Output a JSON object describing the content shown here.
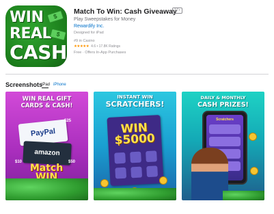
{
  "app": {
    "icon_text": [
      "WIN",
      "REAL",
      "CASH"
    ],
    "title": "Match To Win: Cash Giveaway",
    "age_rating": "17+",
    "subtitle": "Play Sweepstakes for Money",
    "developer": "Rewardify Inc.",
    "designed_for": "Designed for iPad",
    "rank": "#9 in Casino",
    "stars": "★★★★★",
    "rating": 4.6,
    "ratings_text": "4.6 • 17.8K Ratings",
    "price": "Free · Offers In-App Purchases"
  },
  "screenshots": {
    "heading": "Screenshots",
    "tabs": [
      {
        "label": "iPad",
        "selected": true
      },
      {
        "label": "iPhone",
        "selected": false
      }
    ],
    "items": [
      {
        "headline": "WIN REAL GIFT CARDS & CASH!",
        "cards": [
          "PayPal",
          "amazon"
        ],
        "badges": [
          "$25",
          "$10",
          "$50"
        ],
        "logo": [
          "Match",
          "WIN"
        ]
      },
      {
        "headline_top": "INSTANT WIN",
        "headline_main": "SCRATCHERS!",
        "win_text": [
          "WIN",
          "$5000"
        ]
      },
      {
        "headline_top": "DAILY & MONTHLY",
        "headline_main": "CASH PRIZES!",
        "screen_title": "Scratchers"
      }
    ]
  },
  "colors": {
    "link": "#0070c9",
    "icon_green": "#1b7d1b",
    "star": "#ff9500"
  }
}
